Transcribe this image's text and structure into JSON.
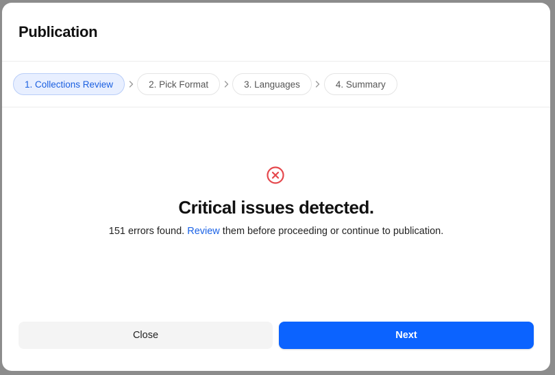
{
  "modal": {
    "title": "Publication"
  },
  "stepper": {
    "steps": [
      {
        "label": "1. Collections Review",
        "active": true
      },
      {
        "label": "2. Pick Format",
        "active": false
      },
      {
        "label": "3. Languages",
        "active": false
      },
      {
        "label": "4. Summary",
        "active": false
      }
    ]
  },
  "status": {
    "icon": "error-circle-x-icon",
    "color": "#e5484d",
    "headline": "Critical issues detected.",
    "message_prefix": "151 errors found. ",
    "message_link": "Review",
    "message_suffix": " them before proceeding or continue to publication."
  },
  "footer": {
    "close_label": "Close",
    "next_label": "Next"
  },
  "colors": {
    "accent": "#0b63ff",
    "link": "#1a62e6",
    "error": "#e5484d"
  }
}
